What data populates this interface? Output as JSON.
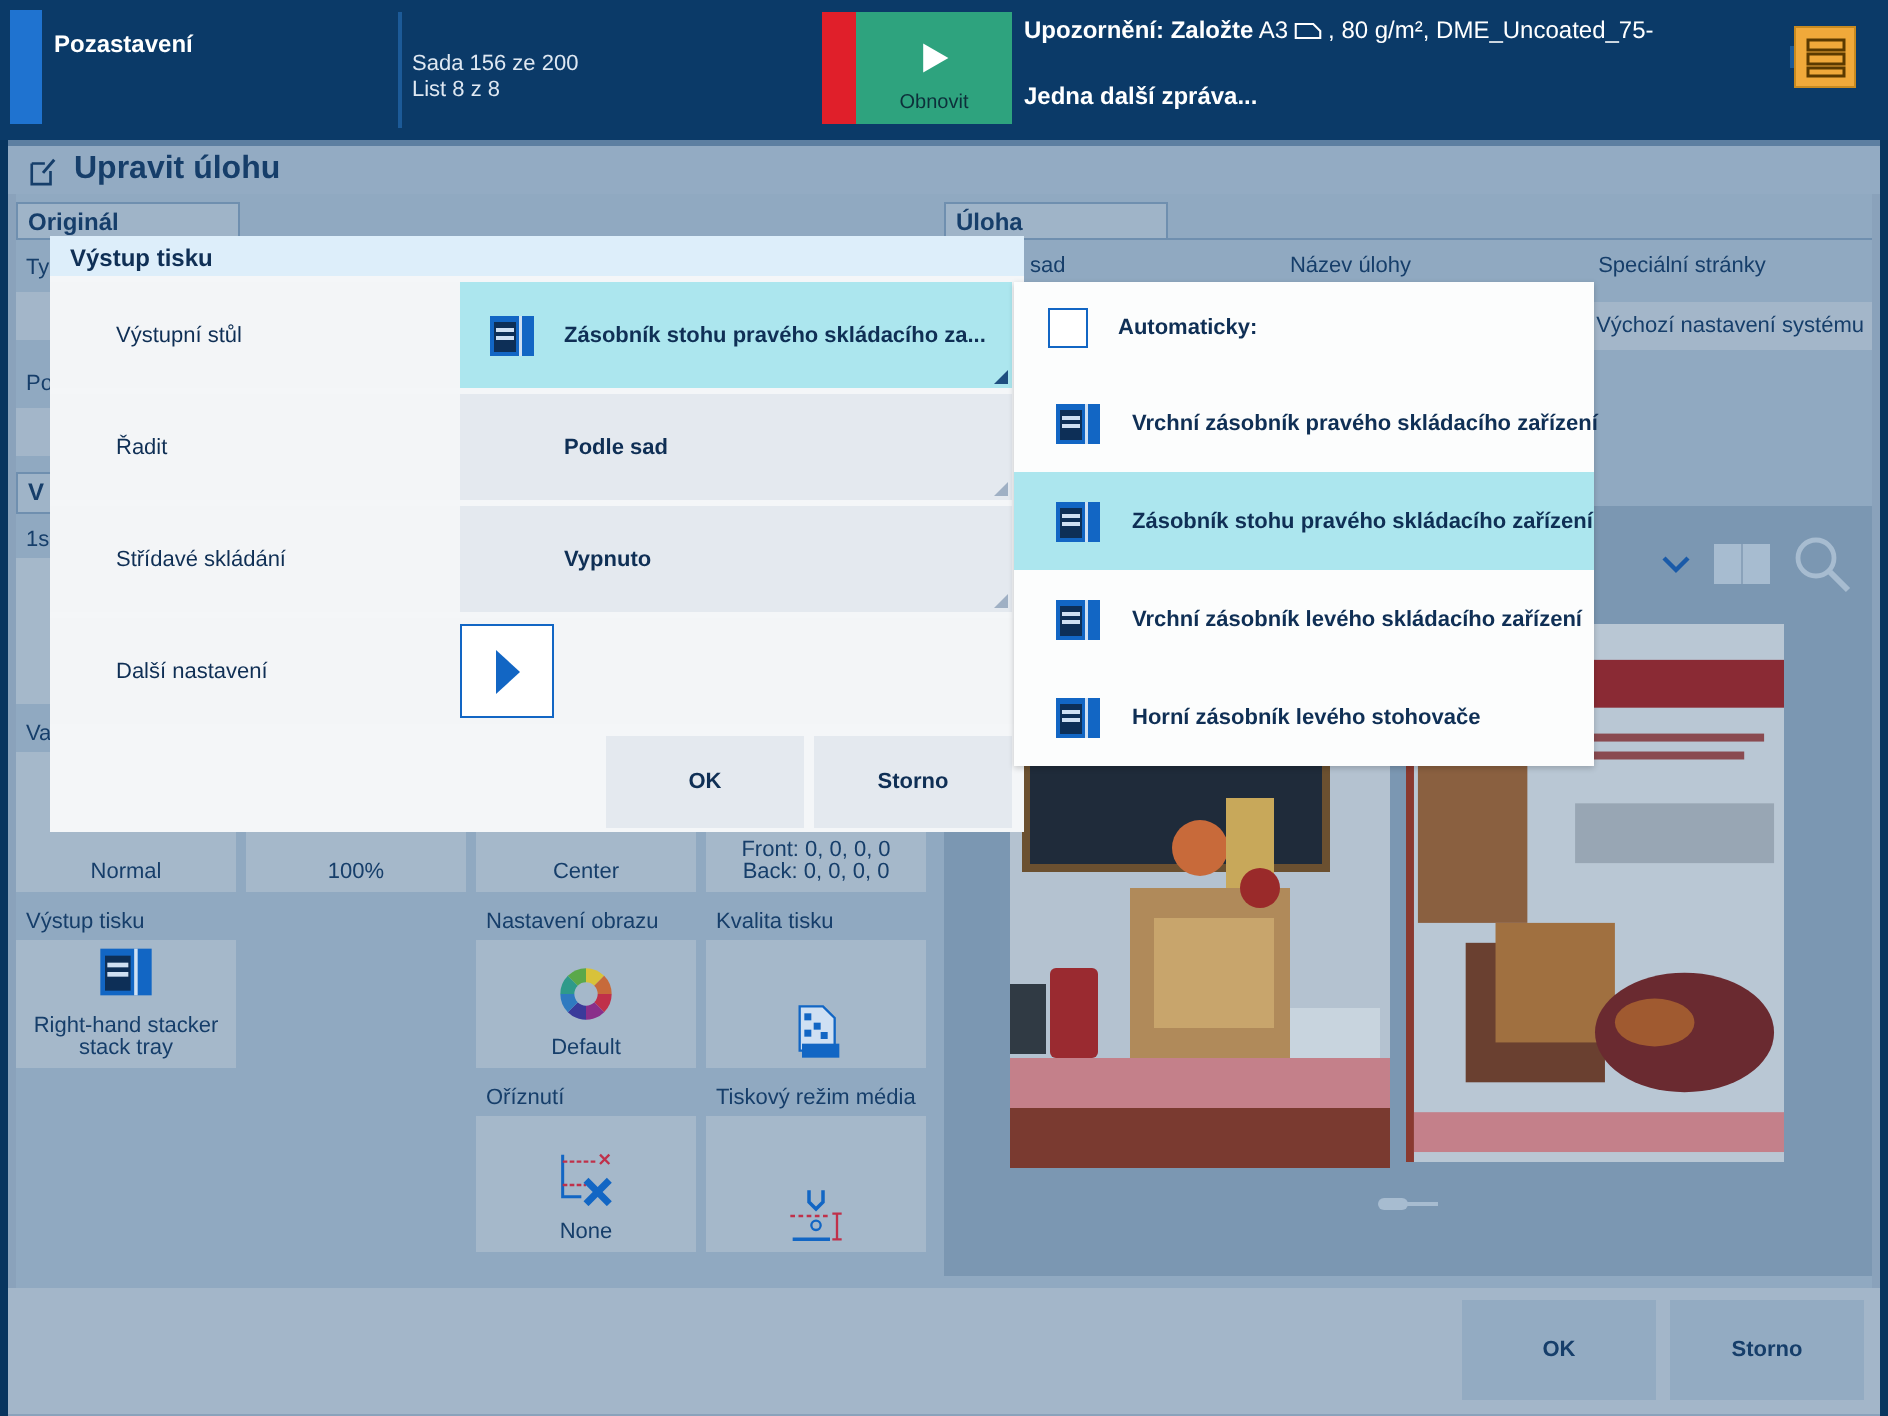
{
  "top_bar": {
    "status": "Pozastavení",
    "counters": [
      "Sada 156 ze 200",
      "List 8 z 8"
    ],
    "resume_button": "Obnovit",
    "message_lead": "**Upozornění: Založte** A3",
    "message_rest": ", 80 g/m², DME_Uncoated_75-",
    "message_more": "Jedna další zpráva..."
  },
  "title": "Upravit úlohu",
  "left_panel": {
    "tab": "Originál",
    "fields": [
      "Ty",
      "Po"
    ],
    "section_tab": "V",
    "tiles": [
      {
        "kind": "tile",
        "label": "1s"
      },
      {
        "kind": "none"
      },
      {
        "kind": "none"
      },
      {
        "kind": "none"
      },
      {
        "kind": "tile",
        "label": "Va",
        "lines": [
          "Normal"
        ]
      },
      {
        "kind": "tile",
        "lines": [
          "100%"
        ]
      },
      {
        "kind": "tile",
        "lines": [
          "Center"
        ]
      },
      {
        "kind": "tile",
        "lines": [
          "Front: 0, 0, 0, 0",
          "Back: 0, 0, 0, 0"
        ]
      },
      {
        "kind": "tile",
        "label": "Výstup tisku",
        "lines": [
          "Right-hand stacker",
          "stack tray"
        ]
      },
      {
        "kind": "none"
      },
      {
        "kind": "tile",
        "label": "Nastavení obrazu",
        "lines": [
          "Default"
        ]
      },
      {
        "kind": "tile",
        "label": "Kvalita tisku"
      },
      {
        "kind": "none"
      },
      {
        "kind": "none"
      },
      {
        "kind": "tile",
        "label": "Oříznutí",
        "lines": [
          "None"
        ]
      },
      {
        "kind": "tile",
        "label": "Tiskový režim média"
      }
    ]
  },
  "right_panel": {
    "tab": "Úloha",
    "columns": [
      {
        "label": "sad"
      },
      {
        "label": "Název úlohy"
      },
      {
        "label": "Speciální stránky",
        "value": "Výchozí nastavení systému"
      }
    ]
  },
  "dialog": {
    "title": "Výstup tisku",
    "rows": [
      {
        "kind": "tray-dropdown",
        "label": "Výstupní stůl",
        "value": "Zásobník stohu pravého skládacího za...",
        "open": true
      },
      {
        "kind": "dropdown",
        "label": "Řadit",
        "value": "Podle sad",
        "open": false
      },
      {
        "kind": "dropdown",
        "label": "Střídavé skládání",
        "value": "Vypnuto",
        "open": false
      },
      {
        "kind": "button",
        "label": "Další nastavení"
      }
    ],
    "buttons": [
      "OK",
      "Storno"
    ]
  },
  "menu": {
    "items": [
      {
        "kind": "checkbox",
        "label": "Automaticky:",
        "checked": false
      },
      {
        "kind": "option",
        "label": "Vrchní zásobník pravého skládacího zařízení",
        "selected": false
      },
      {
        "kind": "option",
        "label": "Zásobník stohu pravého skládacího zařízení",
        "selected": true
      },
      {
        "kind": "option",
        "label": "Vrchní zásobník levého skládacího zařízení",
        "selected": false
      },
      {
        "kind": "option",
        "label": "Horní zásobník levého stohovače",
        "selected": false
      }
    ]
  },
  "footer_buttons": [
    "OK",
    "Storno"
  ]
}
